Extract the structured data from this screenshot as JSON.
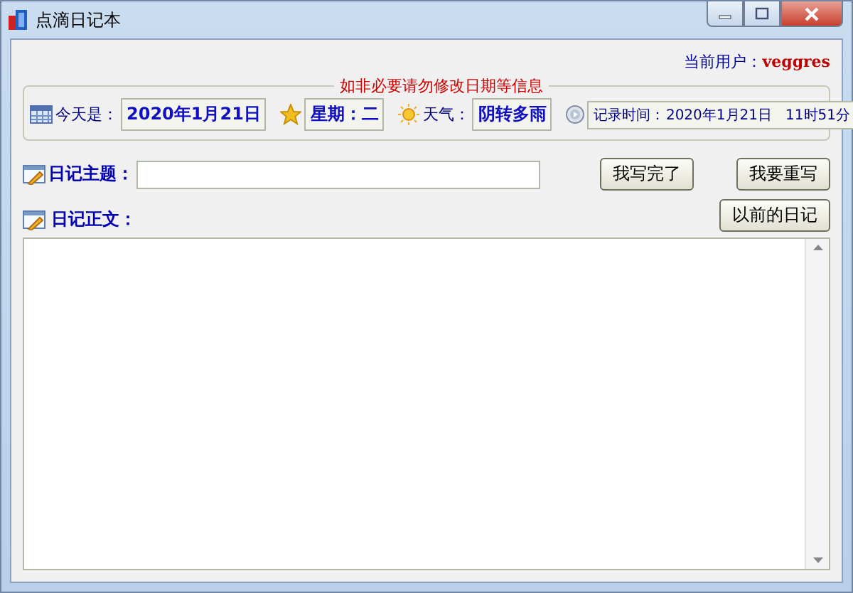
{
  "window": {
    "title": "点滴日记本"
  },
  "user": {
    "label": "当前用户：",
    "name": "veggres"
  },
  "info_group": {
    "legend": "如非必要请勿修改日期等信息",
    "fields": [
      {
        "kind": "date",
        "label": "今天是：",
        "value": "2020年1月21日"
      },
      {
        "kind": "weekday",
        "value": "星期：二"
      },
      {
        "kind": "weather",
        "label": "天气：",
        "value": "阴转多雨"
      },
      {
        "kind": "record_time",
        "label": "记录时间：",
        "value": "2020年1月21日   11时51分"
      }
    ]
  },
  "subject": {
    "label": "日记主题："
  },
  "buttons": [
    {
      "label": "我写完了"
    },
    {
      "label": "我要重写"
    },
    {
      "label": "以前的日记"
    }
  ],
  "body": {
    "label": "日记正文："
  }
}
